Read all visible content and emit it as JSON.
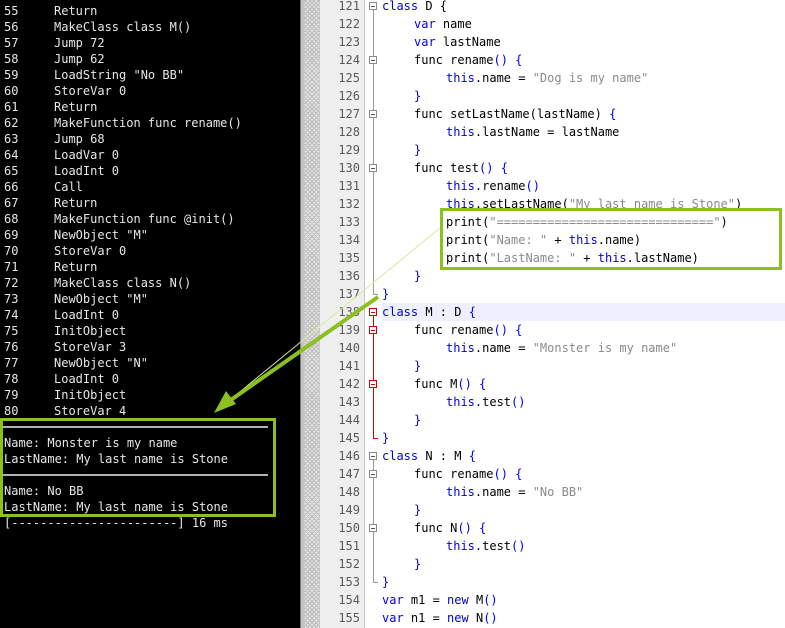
{
  "console": {
    "lines": [
      {
        "n": "55",
        "text": "Return"
      },
      {
        "n": "56",
        "text": "MakeClass class M()"
      },
      {
        "n": "57",
        "text": "Jump 72"
      },
      {
        "n": "58",
        "text": "Jump 62"
      },
      {
        "n": "59",
        "text": "LoadString \"No BB\""
      },
      {
        "n": "60",
        "text": "StoreVar 0"
      },
      {
        "n": "61",
        "text": "Return"
      },
      {
        "n": "62",
        "text": "MakeFunction func rename()"
      },
      {
        "n": "63",
        "text": "Jump 68"
      },
      {
        "n": "64",
        "text": "LoadVar 0"
      },
      {
        "n": "65",
        "text": "LoadInt 0"
      },
      {
        "n": "66",
        "text": "Call"
      },
      {
        "n": "67",
        "text": "Return"
      },
      {
        "n": "68",
        "text": "MakeFunction func @init()"
      },
      {
        "n": "69",
        "text": "NewObject \"M\""
      },
      {
        "n": "70",
        "text": "StoreVar 0"
      },
      {
        "n": "71",
        "text": "Return"
      },
      {
        "n": "72",
        "text": "MakeClass class N()"
      },
      {
        "n": "73",
        "text": "NewObject \"M\""
      },
      {
        "n": "74",
        "text": "LoadInt 0"
      },
      {
        "n": "75",
        "text": "InitObject"
      },
      {
        "n": "76",
        "text": "StoreVar 3"
      },
      {
        "n": "77",
        "text": "NewObject \"N\""
      },
      {
        "n": "78",
        "text": "LoadInt 0"
      },
      {
        "n": "79",
        "text": "InitObject"
      },
      {
        "n": "80",
        "text": "StoreVar 4"
      }
    ],
    "output": {
      "block1": [
        "Name: Monster is my name",
        "LastName: My last name is Stone"
      ],
      "block2": [
        "Name: No BB",
        "LastName: My last name is Stone"
      ],
      "progress": "[-----------------------] 16 ms"
    }
  },
  "editor": {
    "lines": [
      {
        "n": "121",
        "indent": 0,
        "parts": [
          {
            "t": "class",
            "c": "kw"
          },
          {
            "t": " D {"
          }
        ]
      },
      {
        "n": "122",
        "indent": 1,
        "parts": [
          {
            "t": "var",
            "c": "kw"
          },
          {
            "t": " name"
          }
        ]
      },
      {
        "n": "123",
        "indent": 1,
        "parts": [
          {
            "t": "var",
            "c": "kw"
          },
          {
            "t": " lastName"
          }
        ]
      },
      {
        "n": "124",
        "indent": 1,
        "parts": [
          {
            "t": "func rename"
          },
          {
            "t": "()",
            "c": "kw"
          },
          {
            "t": " {",
            "c": "kw"
          }
        ]
      },
      {
        "n": "125",
        "indent": 2,
        "parts": [
          {
            "t": "this",
            "c": "kw"
          },
          {
            "t": ".name = "
          },
          {
            "t": "\"Dog is my name\"",
            "c": "str"
          }
        ]
      },
      {
        "n": "126",
        "indent": 1,
        "parts": [
          {
            "t": "}",
            "c": "kw"
          }
        ]
      },
      {
        "n": "127",
        "indent": 1,
        "parts": [
          {
            "t": "func setLastName(lastName) "
          },
          {
            "t": "{",
            "c": "kw"
          }
        ]
      },
      {
        "n": "128",
        "indent": 2,
        "parts": [
          {
            "t": "this",
            "c": "kw"
          },
          {
            "t": ".lastName = lastName"
          }
        ]
      },
      {
        "n": "129",
        "indent": 1,
        "parts": [
          {
            "t": "}",
            "c": "kw"
          }
        ]
      },
      {
        "n": "130",
        "indent": 1,
        "parts": [
          {
            "t": "func test"
          },
          {
            "t": "()",
            "c": "kw"
          },
          {
            "t": " {",
            "c": "kw"
          }
        ]
      },
      {
        "n": "131",
        "indent": 2,
        "parts": [
          {
            "t": "this",
            "c": "kw"
          },
          {
            "t": ".rename"
          },
          {
            "t": "()",
            "c": "kw"
          }
        ]
      },
      {
        "n": "132",
        "indent": 2,
        "parts": [
          {
            "t": "this",
            "c": "kw"
          },
          {
            "t": ".setLastName("
          },
          {
            "t": "\"My last name is Stone\"",
            "c": "str"
          },
          {
            "t": ")"
          }
        ]
      },
      {
        "n": "133",
        "indent": 2,
        "parts": [
          {
            "t": "print("
          },
          {
            "t": "\"==============================\"",
            "c": "str"
          },
          {
            "t": ")"
          }
        ]
      },
      {
        "n": "134",
        "indent": 2,
        "parts": [
          {
            "t": "print("
          },
          {
            "t": "\"Name: \"",
            "c": "str"
          },
          {
            "t": " + "
          },
          {
            "t": "this",
            "c": "kw"
          },
          {
            "t": ".name)"
          }
        ]
      },
      {
        "n": "135",
        "indent": 2,
        "parts": [
          {
            "t": "print("
          },
          {
            "t": "\"LastName: \"",
            "c": "str"
          },
          {
            "t": " + "
          },
          {
            "t": "this",
            "c": "kw"
          },
          {
            "t": ".lastName)"
          }
        ]
      },
      {
        "n": "136",
        "indent": 1,
        "parts": [
          {
            "t": "}",
            "c": "kw"
          }
        ]
      },
      {
        "n": "137",
        "indent": 0,
        "parts": [
          {
            "t": "}",
            "c": "kw"
          }
        ]
      },
      {
        "n": "138",
        "indent": 0,
        "parts": [
          {
            "t": "class",
            "c": "kw"
          },
          {
            "t": " M : D "
          },
          {
            "t": "{",
            "c": "kw"
          }
        ]
      },
      {
        "n": "139",
        "indent": 1,
        "parts": [
          {
            "t": "func rename"
          },
          {
            "t": "()",
            "c": "kw"
          },
          {
            "t": " {",
            "c": "kw"
          }
        ]
      },
      {
        "n": "140",
        "indent": 2,
        "parts": [
          {
            "t": "this",
            "c": "kw"
          },
          {
            "t": ".name = "
          },
          {
            "t": "\"Monster is my name\"",
            "c": "str"
          }
        ]
      },
      {
        "n": "141",
        "indent": 1,
        "parts": [
          {
            "t": "}",
            "c": "kw"
          }
        ]
      },
      {
        "n": "142",
        "indent": 1,
        "parts": [
          {
            "t": "func M"
          },
          {
            "t": "()",
            "c": "kw"
          },
          {
            "t": " {",
            "c": "kw"
          }
        ]
      },
      {
        "n": "143",
        "indent": 2,
        "parts": [
          {
            "t": "this",
            "c": "kw"
          },
          {
            "t": ".test"
          },
          {
            "t": "()",
            "c": "kw"
          }
        ]
      },
      {
        "n": "144",
        "indent": 1,
        "parts": [
          {
            "t": "}",
            "c": "kw"
          }
        ]
      },
      {
        "n": "145",
        "indent": 0,
        "parts": [
          {
            "t": "}",
            "c": "kw"
          }
        ]
      },
      {
        "n": "146",
        "indent": 0,
        "parts": [
          {
            "t": "class",
            "c": "kw"
          },
          {
            "t": " N : M "
          },
          {
            "t": "{",
            "c": "kw"
          }
        ]
      },
      {
        "n": "147",
        "indent": 1,
        "parts": [
          {
            "t": "func rename"
          },
          {
            "t": "()",
            "c": "kw"
          },
          {
            "t": " {",
            "c": "kw"
          }
        ]
      },
      {
        "n": "148",
        "indent": 2,
        "parts": [
          {
            "t": "this",
            "c": "kw"
          },
          {
            "t": ".name = "
          },
          {
            "t": "\"No BB\"",
            "c": "str"
          }
        ]
      },
      {
        "n": "149",
        "indent": 1,
        "parts": [
          {
            "t": "}",
            "c": "kw"
          }
        ]
      },
      {
        "n": "150",
        "indent": 1,
        "parts": [
          {
            "t": "func N"
          },
          {
            "t": "()",
            "c": "kw"
          },
          {
            "t": " {",
            "c": "kw"
          }
        ]
      },
      {
        "n": "151",
        "indent": 2,
        "parts": [
          {
            "t": "this",
            "c": "kw"
          },
          {
            "t": ".test"
          },
          {
            "t": "()",
            "c": "kw"
          }
        ]
      },
      {
        "n": "152",
        "indent": 1,
        "parts": [
          {
            "t": "}",
            "c": "kw"
          }
        ]
      },
      {
        "n": "153",
        "indent": 0,
        "parts": [
          {
            "t": "}",
            "c": "kw"
          }
        ]
      },
      {
        "n": "154",
        "indent": 0,
        "parts": [
          {
            "t": "var",
            "c": "kw"
          },
          {
            "t": " m1 = "
          },
          {
            "t": "new",
            "c": "kw"
          },
          {
            "t": " M"
          },
          {
            "t": "()",
            "c": "kw"
          }
        ]
      },
      {
        "n": "155",
        "indent": 0,
        "parts": [
          {
            "t": "var",
            "c": "kw"
          },
          {
            "t": " n1 = "
          },
          {
            "t": "new",
            "c": "kw"
          },
          {
            "t": " N"
          },
          {
            "t": "()",
            "c": "kw"
          }
        ]
      }
    ]
  },
  "colors": {
    "annotation_green": "#8cc020",
    "keyword_blue": "#0000e6",
    "string_gray": "#8a8a8a",
    "fold_red": "#d00000"
  }
}
